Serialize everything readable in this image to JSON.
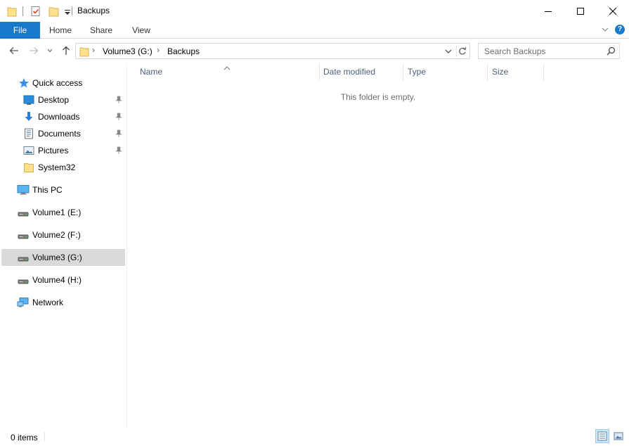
{
  "window": {
    "title": "Backups",
    "minimize_label": "—",
    "maximize_label": "☐",
    "close_label": "✕"
  },
  "ribbon": {
    "tabs": [
      {
        "label": "File"
      },
      {
        "label": "Home"
      },
      {
        "label": "Share"
      },
      {
        "label": "View"
      }
    ],
    "help_label": "?"
  },
  "address": {
    "crumbs": [
      "Volume3 (G:)",
      "Backups"
    ],
    "crumb_separator": "›"
  },
  "search": {
    "placeholder": "Search Backups"
  },
  "navpane": {
    "quick_access": "Quick access",
    "pinned": [
      {
        "label": "Desktop",
        "icon": "desktop-icon",
        "pinned": true
      },
      {
        "label": "Downloads",
        "icon": "download-icon",
        "pinned": true
      },
      {
        "label": "Documents",
        "icon": "documents-icon",
        "pinned": true
      },
      {
        "label": "Pictures",
        "icon": "pictures-icon",
        "pinned": true
      },
      {
        "label": "System32",
        "icon": "folder-icon",
        "pinned": false
      }
    ],
    "this_pc": "This PC",
    "drives": [
      {
        "label": "Volume1 (E:)"
      },
      {
        "label": "Volume2 (F:)"
      },
      {
        "label": "Volume3 (G:)",
        "selected": true
      },
      {
        "label": "Volume4 (H:)"
      }
    ],
    "network": "Network"
  },
  "columns": [
    {
      "label": "Name"
    },
    {
      "label": "Date modified"
    },
    {
      "label": "Type"
    },
    {
      "label": "Size"
    }
  ],
  "content": {
    "empty_message": "This folder is empty."
  },
  "status": {
    "item_count": "0 items"
  },
  "colors": {
    "accent": "#1979ca",
    "selection": "#d9d9d9",
    "header_text": "#4c607a"
  }
}
